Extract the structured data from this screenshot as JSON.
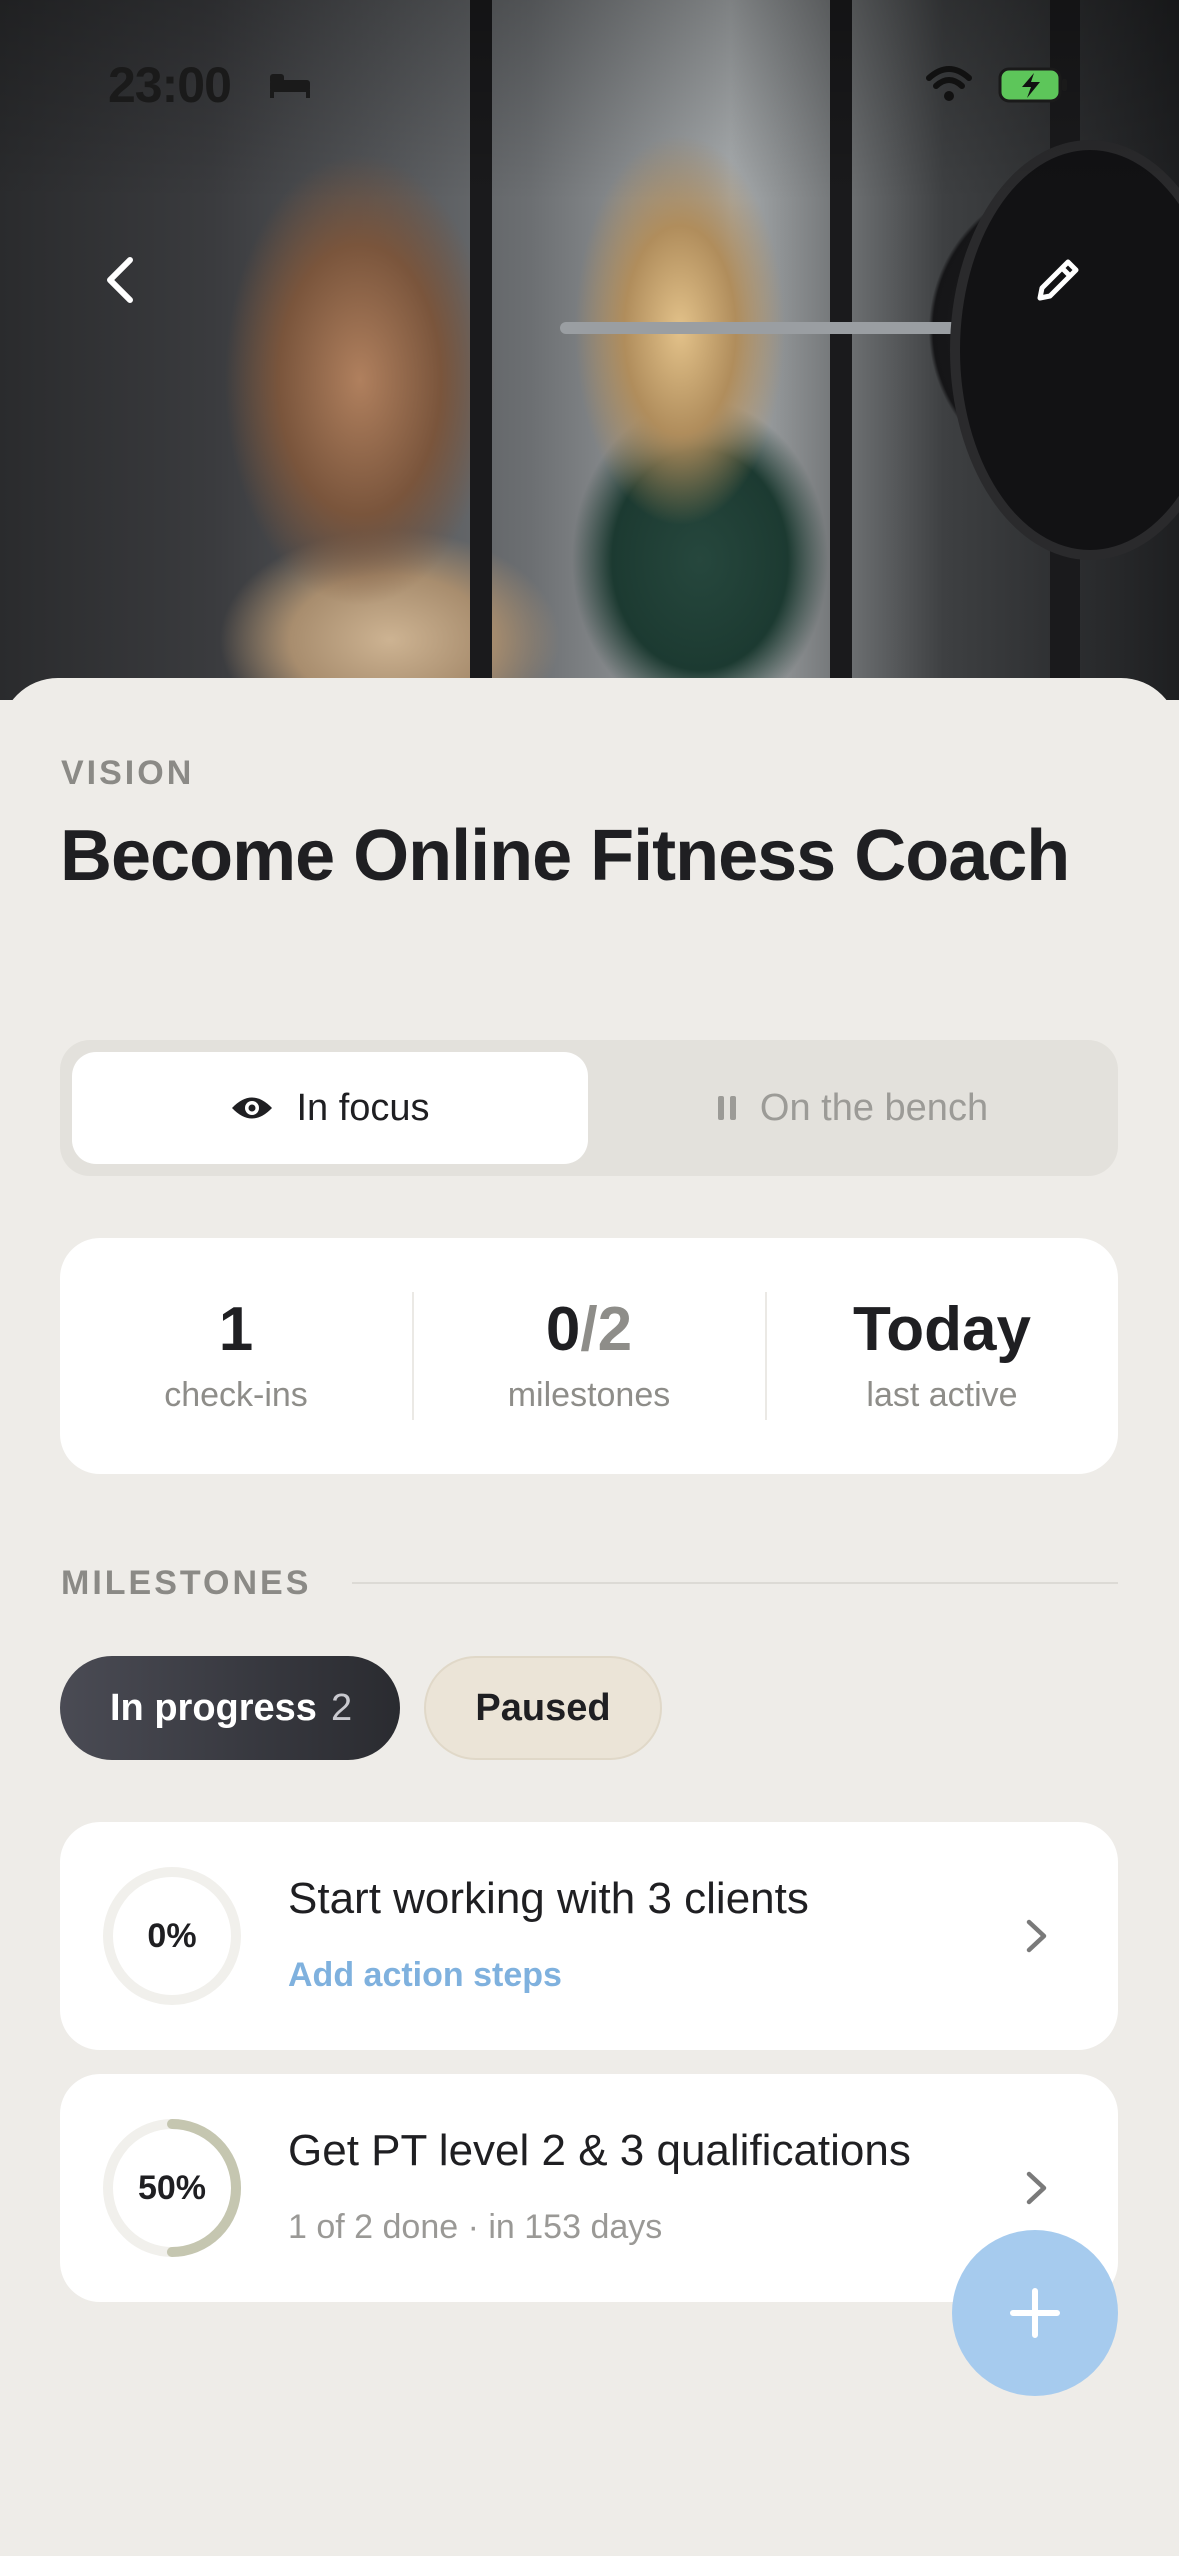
{
  "status_bar": {
    "time": "23:00"
  },
  "vision": {
    "eyebrow": "VISION",
    "title": "Become Online Fitness Coach"
  },
  "segment": {
    "focus_label": "In focus",
    "bench_label": "On the bench",
    "selected": "In focus"
  },
  "stats": [
    {
      "value": "1",
      "label": "check-ins"
    },
    {
      "value_done": "0",
      "value_sep": "/",
      "value_total": "2",
      "label": "milestones"
    },
    {
      "value": "Today",
      "label": "last active"
    }
  ],
  "milestones": {
    "section_label": "MILESTONES",
    "filters": {
      "in_progress_label": "In progress",
      "in_progress_count": "2",
      "paused_label": "Paused",
      "selected": "In progress"
    },
    "items": [
      {
        "progress": "0%",
        "progress_fraction": 0.0,
        "title": "Start working with 3 clients",
        "subtitle": "Add action steps"
      },
      {
        "progress": "50%",
        "progress_fraction": 0.5,
        "title": "Get PT level 2 & 3 qualifications",
        "subtitle": "1 of 2 done · in 153 days"
      }
    ]
  },
  "colors": {
    "background": "#eeece8",
    "accent_blue": "#7fb1de",
    "fab": "#a6cbee",
    "chip_active": "#2a2b30",
    "progress_ring": "#c5c6b0"
  },
  "icons": {
    "back": "chevron-left-icon",
    "edit": "pencil-icon",
    "focus": "eye-icon",
    "bench": "pause-icon",
    "row": "chevron-right-icon",
    "fab": "plus-icon"
  }
}
